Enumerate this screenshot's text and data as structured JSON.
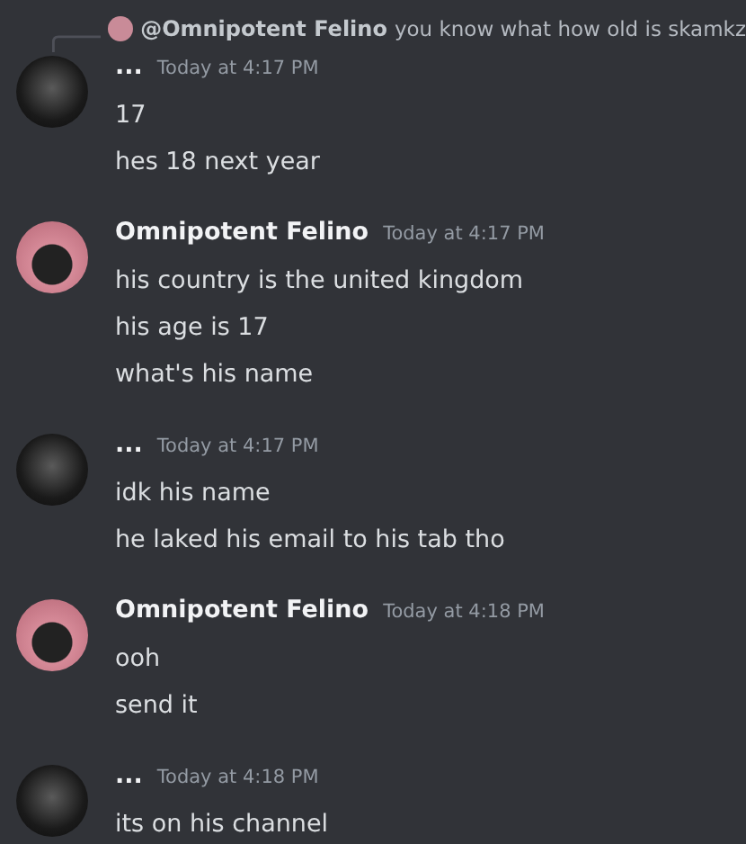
{
  "reply": {
    "author": "@Omnipotent Felino",
    "text": "you know what how old is skamkz"
  },
  "groups": [
    {
      "author": "...",
      "kind": "dark",
      "time": "Today at 4:17 PM",
      "messages": [
        "17",
        "hes 18 next year"
      ]
    },
    {
      "author": "Omnipotent Felino",
      "kind": "pink",
      "time": "Today at 4:17 PM",
      "messages": [
        "his country is the united kingdom",
        "his age is 17",
        "what's his name"
      ]
    },
    {
      "author": "...",
      "kind": "dark",
      "time": "Today at 4:17 PM",
      "messages": [
        "idk his name",
        "he laked his email to his tab tho"
      ]
    },
    {
      "author": "Omnipotent Felino",
      "kind": "pink",
      "time": "Today at 4:18 PM",
      "messages": [
        "ooh",
        "send it"
      ]
    },
    {
      "author": "...",
      "kind": "dark",
      "time": "Today at 4:18 PM",
      "messages": [
        "its on his channel"
      ]
    }
  ]
}
